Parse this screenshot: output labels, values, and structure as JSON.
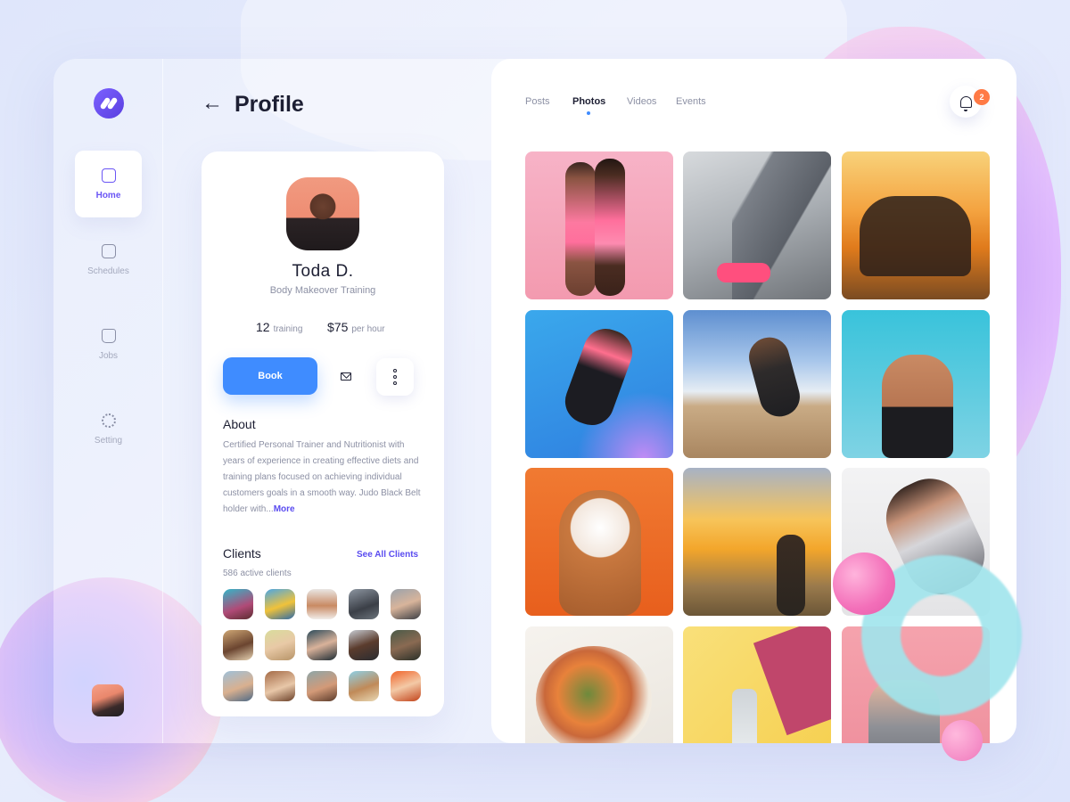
{
  "header": {
    "back_symbol": "←",
    "title": "Profile"
  },
  "sidebar": {
    "items": [
      {
        "label": "Home",
        "icon": "chart-icon",
        "active": true
      },
      {
        "label": "Schedules",
        "icon": "calendar-icon",
        "active": false
      },
      {
        "label": "Jobs",
        "icon": "briefcase-icon",
        "active": false
      },
      {
        "label": "Setting",
        "icon": "gear-icon",
        "active": false
      }
    ]
  },
  "profile": {
    "name": "Toda D.",
    "subtitle": "Body Makeover Training",
    "training_count": "12",
    "training_label": "training",
    "price": "$75",
    "price_label": "per hour",
    "book_label": "Book",
    "about_title": "About",
    "about_text": "Certified Personal Trainer and Nutritionist with years of experience in creating effective diets and training plans focused on achieving individual customers goals in a smooth way. Judo Black Belt holder with...",
    "about_more": "More",
    "clients_title": "Clients",
    "see_all_label": "See All Clients",
    "clients_count": "586 active clients"
  },
  "tabs": [
    {
      "label": "Posts",
      "active": false
    },
    {
      "label": "Photos",
      "active": true
    },
    {
      "label": "Videos",
      "active": false
    },
    {
      "label": "Events",
      "active": false
    }
  ],
  "notifications": {
    "count": "2"
  },
  "colors": {
    "accent": "#3f8cff",
    "brand": "#6a55f5",
    "badge": "#ff7a45"
  }
}
